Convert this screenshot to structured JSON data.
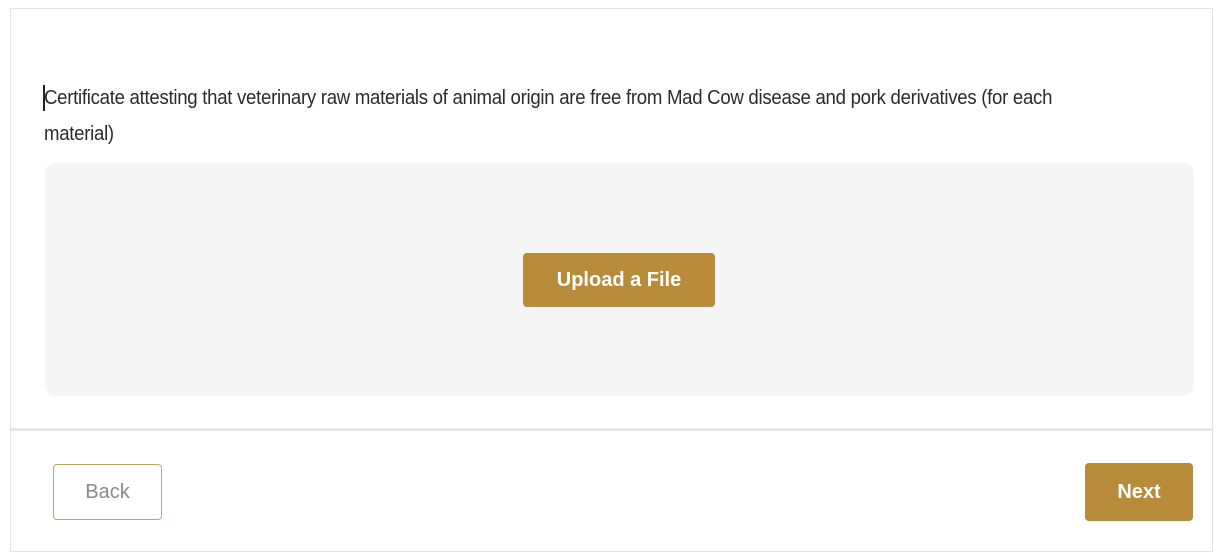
{
  "document_section": {
    "label": "Certificate attesting that veterinary raw materials of animal origin are free from Mad Cow disease and pork derivatives (for each material)",
    "upload_button_label": "Upload a File"
  },
  "navigation": {
    "back_label": "Back",
    "next_label": "Next"
  },
  "colors": {
    "accent": "#b88b3a",
    "dropzone_background": "#f5f5f5",
    "back_border": "#c9a25a"
  }
}
